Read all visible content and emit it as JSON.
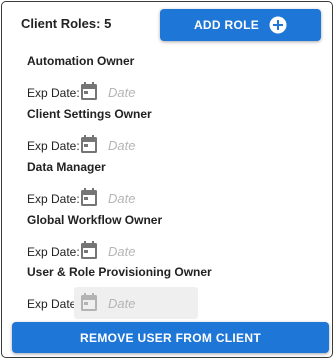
{
  "header": {
    "count_label": "Client Roles: 5",
    "add_button_label": "ADD ROLE",
    "add_icon": "plus-circle-icon"
  },
  "roles": [
    {
      "name": "Automation Owner",
      "exp_label": "Exp Date:",
      "date_placeholder": "Date",
      "disabled": false
    },
    {
      "name": "Client Settings Owner",
      "exp_label": "Exp Date:",
      "date_placeholder": "Date",
      "disabled": false
    },
    {
      "name": "Data Manager",
      "exp_label": "Exp Date:",
      "date_placeholder": "Date",
      "disabled": false
    },
    {
      "name": "Global Workflow Owner",
      "exp_label": "Exp Date:",
      "date_placeholder": "Date",
      "disabled": false
    },
    {
      "name": "User & Role Provisioning Owner",
      "exp_label": "Exp Date:",
      "date_placeholder": "Date",
      "disabled": true
    }
  ],
  "footer": {
    "remove_button_label": "REMOVE USER FROM CLIENT"
  },
  "colors": {
    "primary": "#1e76d7",
    "icon_gray": "#757575",
    "disabled_field": "#efefef"
  },
  "icons": {
    "date_field": "calendar-icon"
  }
}
